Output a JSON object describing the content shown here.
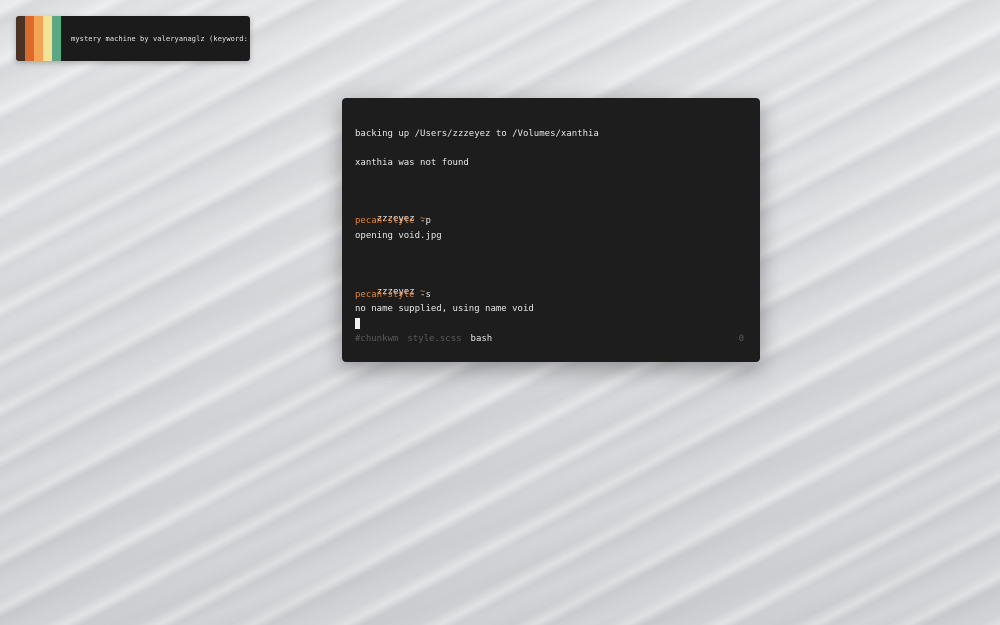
{
  "palette": {
    "label": "mystery machine by valeryanaglz (keyword: )",
    "colors": [
      "#4b3223",
      "#dd6a2a",
      "#f2a455",
      "#efe49a",
      "#5aa784"
    ]
  },
  "terminal": {
    "lines": [
      {
        "text": "backing up /Users/zzzeyez to /Volumes/xanthia"
      },
      {
        "text": "xanthia was not found"
      },
      {
        "prompt_user": "zzzeyez",
        "prompt_symbol": "~"
      },
      {
        "command": "pecan-style",
        "args": " -p"
      },
      {
        "text": "opening void.jpg"
      },
      {
        "prompt_user": "zzzeyez",
        "prompt_symbol": "~"
      },
      {
        "command": "pecan-style",
        "args": " -s"
      },
      {
        "text": "no name supplied, using name void"
      }
    ],
    "status": {
      "tabs": [
        "#chunkwm",
        "style.scss",
        "bash"
      ],
      "active_tab": "bash",
      "count": "0"
    },
    "accent_color": "#e0803a"
  }
}
